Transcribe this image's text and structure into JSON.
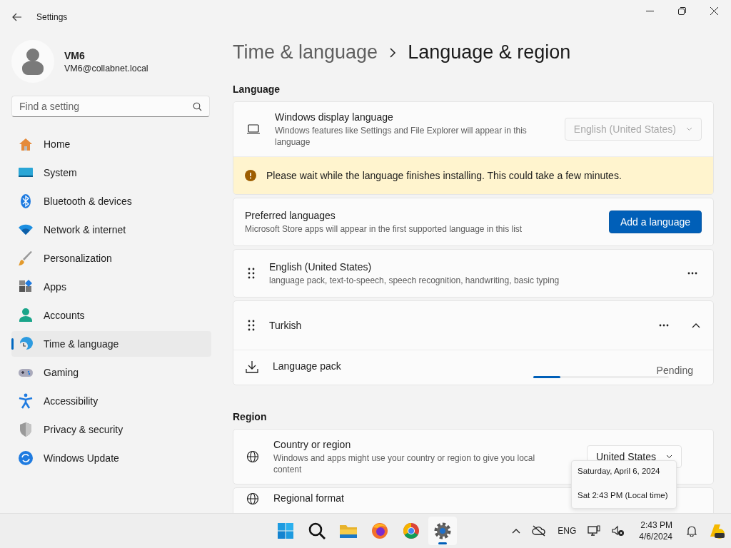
{
  "window": {
    "title": "Settings"
  },
  "account": {
    "name": "VM6",
    "email": "VM6@collabnet.local"
  },
  "search": {
    "placeholder": "Find a setting"
  },
  "nav": [
    {
      "label": "Home",
      "selected": false
    },
    {
      "label": "System",
      "selected": false
    },
    {
      "label": "Bluetooth & devices",
      "selected": false
    },
    {
      "label": "Network & internet",
      "selected": false
    },
    {
      "label": "Personalization",
      "selected": false
    },
    {
      "label": "Apps",
      "selected": false
    },
    {
      "label": "Accounts",
      "selected": false
    },
    {
      "label": "Time & language",
      "selected": true
    },
    {
      "label": "Gaming",
      "selected": false
    },
    {
      "label": "Accessibility",
      "selected": false
    },
    {
      "label": "Privacy & security",
      "selected": false
    },
    {
      "label": "Windows Update",
      "selected": false
    }
  ],
  "breadcrumb": {
    "parent": "Time & language",
    "current": "Language & region"
  },
  "language_section": {
    "heading": "Language",
    "display_language": {
      "title": "Windows display language",
      "description": "Windows features like Settings and File Explorer will appear in this language",
      "value": "English (United States)",
      "disabled": true
    },
    "warning": "Please wait while the language finishes installing. This could take a few minutes.",
    "preferred": {
      "title": "Preferred languages",
      "description": "Microsoft Store apps will appear in the first supported language in this list",
      "button": "Add a language"
    },
    "languages": [
      {
        "kind": "basic",
        "name": "English (United States)",
        "features": "language pack, text-to-speech, speech recognition, handwriting, basic typing"
      },
      {
        "kind": "expandable",
        "name": "Turkish",
        "expanded": true,
        "items": [
          {
            "name": "Language pack",
            "status": "Pending",
            "level": 0.2
          }
        ]
      }
    ]
  },
  "region_section": {
    "heading": "Region",
    "rows": [
      {
        "title": "Country or region",
        "description": "Windows and apps might use your country or region to give you local content",
        "value": "United States"
      },
      {
        "title": "Regional format"
      }
    ]
  },
  "tooltip": {
    "lines": [
      "Saturday, April 6, 2024",
      "Sat 2:43 PM (Local time)"
    ]
  },
  "taskbar": {
    "apps": [
      {
        "selected": false
      },
      {
        "selected": false
      },
      {
        "selected": false
      },
      {
        "selected": false
      },
      {
        "selected": false
      },
      {
        "selected": true
      }
    ],
    "language": "ENG",
    "time": "2:43 PM",
    "date": "4/6/2024"
  }
}
